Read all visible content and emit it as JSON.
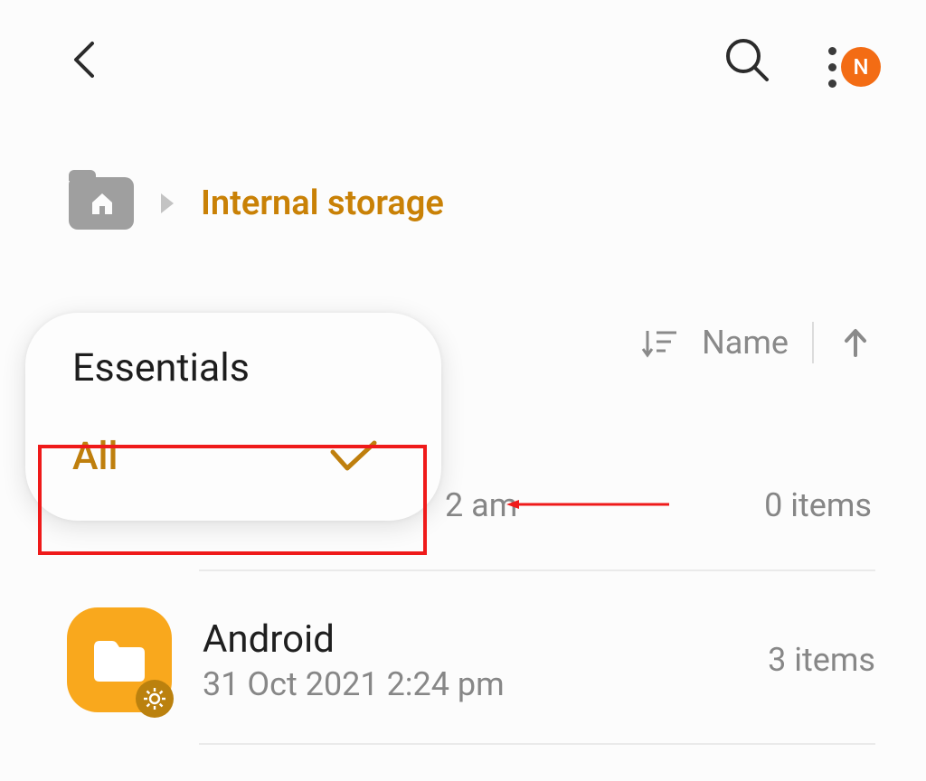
{
  "avatar_letter": "N",
  "breadcrumb": {
    "current": "Internal storage"
  },
  "sort": {
    "label": "Name"
  },
  "dropdown": {
    "items": [
      "Essentials",
      "All"
    ],
    "selected": "All"
  },
  "row_hidden": {
    "time_suffix": "2 am",
    "count": "0 items"
  },
  "row2": {
    "title": "Android",
    "subtitle": "31 Oct 2021 2:24 pm",
    "count": "3 items"
  }
}
